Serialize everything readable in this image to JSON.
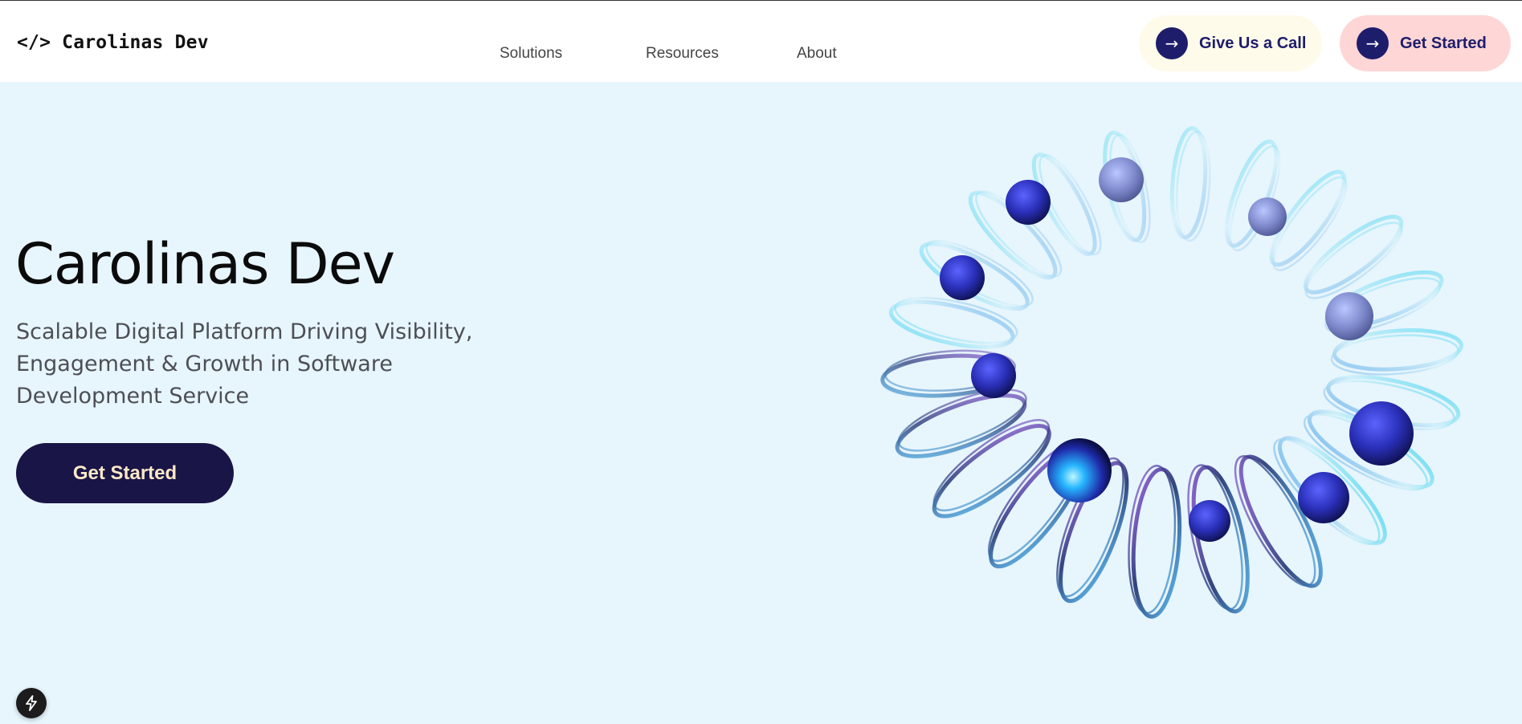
{
  "header": {
    "logo_mark": "</>",
    "logo_text": "Carolinas Dev",
    "nav": [
      "Solutions",
      "Resources",
      "About"
    ],
    "call_button": {
      "icon": "arrow-right-icon",
      "glyph": "→",
      "label": "Give Us a Call"
    },
    "start_button": {
      "icon": "arrow-right-icon",
      "glyph": "→",
      "label": "Get Started"
    }
  },
  "hero": {
    "title": "Carolinas Dev",
    "subtitle": "Scalable Digital Platform Driving Visibility, Engagement & Growth in Software Development Service",
    "cta_label": "Get Started",
    "art": "glass-rings-torus-illustration"
  },
  "dev_badge": {
    "icon": "lightning-icon"
  },
  "colors": {
    "navy": "#1e1d6b",
    "cta_bg": "#191547",
    "cta_text": "#fce9c7",
    "hero_bg": "#e7f5fd",
    "call_pill_bg": "#fffbea",
    "start_pill_bg": "#ffd6d6"
  }
}
